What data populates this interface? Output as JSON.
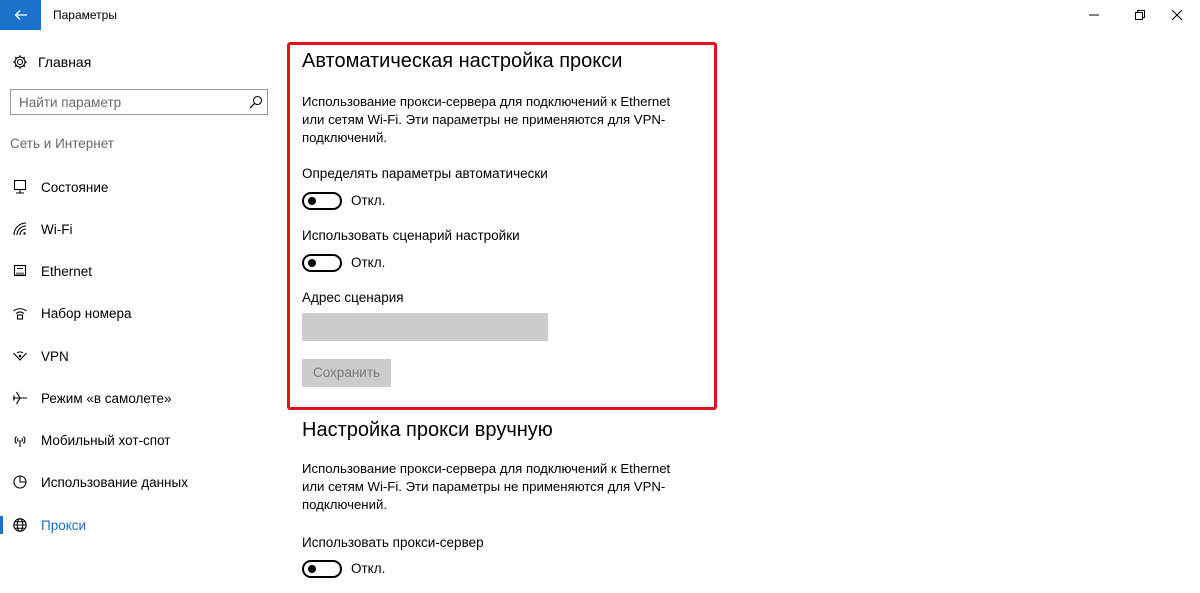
{
  "window": {
    "title": "Параметры"
  },
  "sidebar": {
    "home_label": "Главная",
    "search_placeholder": "Найти параметр",
    "section_title": "Сеть и Интернет",
    "items": [
      {
        "label": "Состояние",
        "icon": "status-icon"
      },
      {
        "label": "Wi-Fi",
        "icon": "wifi-icon"
      },
      {
        "label": "Ethernet",
        "icon": "ethernet-icon"
      },
      {
        "label": "Набор номера",
        "icon": "dialup-icon"
      },
      {
        "label": "VPN",
        "icon": "vpn-icon"
      },
      {
        "label": "Режим «в самолете»",
        "icon": "airplane-icon"
      },
      {
        "label": "Мобильный хот-спот",
        "icon": "hotspot-icon"
      },
      {
        "label": "Использование данных",
        "icon": "data-usage-icon"
      },
      {
        "label": "Прокси",
        "icon": "globe-icon",
        "active": true
      }
    ]
  },
  "auto_proxy": {
    "heading": "Автоматическая настройка прокси",
    "description_lines": [
      "Использование прокси-сервера для подключений к Ethernet",
      "или сетям Wi-Fi. Эти параметры не применяются для VPN-",
      "подключений."
    ],
    "detect_label": "Определять параметры автоматически",
    "detect_state": "Откл.",
    "script_label": "Использовать сценарий настройки",
    "script_state": "Откл.",
    "address_label": "Адрес сценария",
    "address_value": "",
    "save_label": "Сохранить"
  },
  "manual_proxy": {
    "heading": "Настройка прокси вручную",
    "description_lines": [
      "Использование прокси-сервера для подключений к Ethernet",
      "или сетям Wi-Fi. Эти параметры не применяются для VPN-",
      "подключений."
    ],
    "use_proxy_label": "Использовать прокси-сервер",
    "use_proxy_state": "Откл."
  },
  "colors": {
    "accent": "#1a73c9",
    "highlight": "#e0141e",
    "disabled": "#cccccc"
  }
}
